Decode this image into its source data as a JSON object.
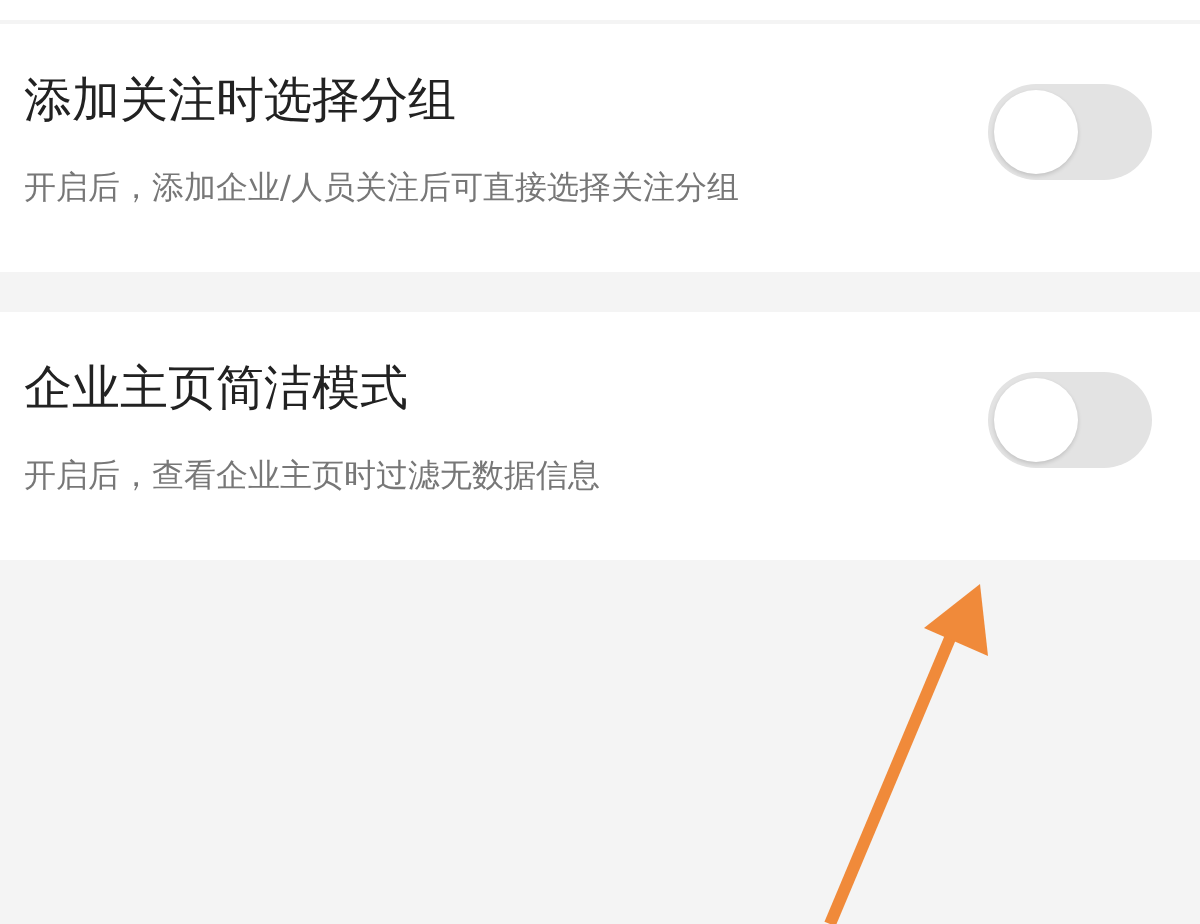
{
  "settings": [
    {
      "title": "添加关注时选择分组",
      "description": "开启后，添加企业/人员关注后可直接选择关注分组",
      "on": false
    },
    {
      "title": "企业主页简洁模式",
      "description": "开启后，查看企业主页时过滤无数据信息",
      "on": false
    }
  ]
}
